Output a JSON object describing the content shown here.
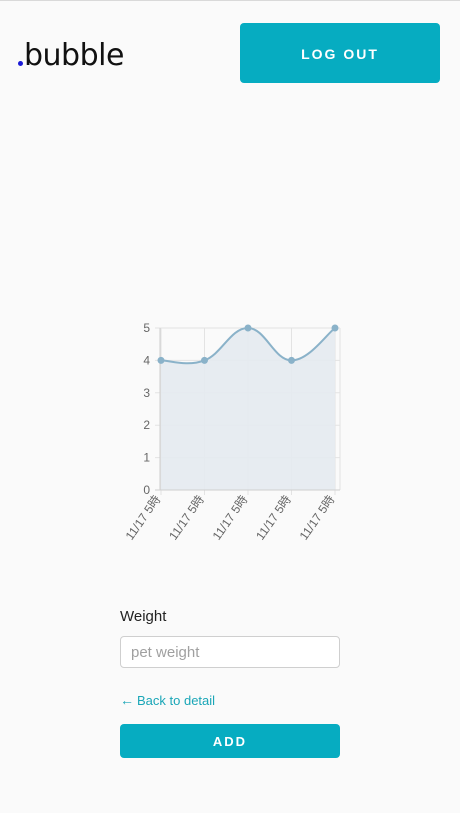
{
  "header": {
    "logo_text": "bubble",
    "logout_label": "LOG OUT"
  },
  "colors": {
    "accent": "#06acc1",
    "logo_dot": "#1a1ad6",
    "series_line": "#8ab2c9",
    "series_fill": "#e4eaf0",
    "link": "#1aa6b7"
  },
  "chart_data": {
    "type": "area",
    "categories": [
      "11/17 5時",
      "11/17 5時",
      "11/17 5時",
      "11/17 5時",
      "11/17 5時"
    ],
    "series": [
      {
        "values": [
          4,
          4,
          5,
          4,
          5
        ]
      }
    ],
    "ylim": [
      0,
      5
    ],
    "yticks": [
      0,
      1,
      2,
      3,
      4,
      5
    ],
    "grid": true,
    "legend": "none"
  },
  "form": {
    "weight_label": "Weight",
    "weight_placeholder": "pet weight",
    "weight_value": "",
    "back_link_label": "Back to detail",
    "back_icon": "arrow-left-icon",
    "add_label": "ADD"
  }
}
